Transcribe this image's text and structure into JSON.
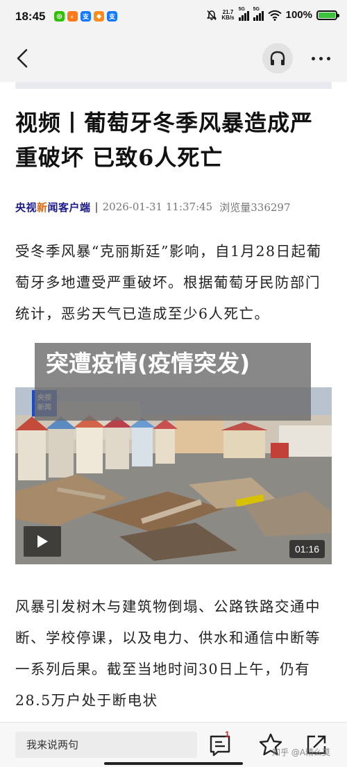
{
  "status_bar": {
    "time": "18:45",
    "apps": [
      {
        "name": "wechat",
        "color": "#2dc100",
        "glyph": "◎"
      },
      {
        "name": "xianyu",
        "color": "#ff7a1a",
        "glyph": "◐"
      },
      {
        "name": "alipay",
        "color": "#1677ff",
        "glyph": "支"
      },
      {
        "name": "taobao",
        "color": "#ff8c1a",
        "glyph": "◆"
      },
      {
        "name": "alipay-2",
        "color": "#1677ff",
        "glyph": "支"
      }
    ],
    "net_speed_value": "21.7",
    "net_speed_unit": "KB/s",
    "signal1_label": "5G",
    "signal2_label": "5G",
    "battery": "100%",
    "battery_level": 1.0,
    "battery_color": "#3cc23c"
  },
  "nav": {
    "back_icon": "chevron-left-icon",
    "listen_icon": "headphones-icon",
    "more_icon": "more-dots-icon"
  },
  "article": {
    "title": "视频丨葡萄牙冬季风暴造成严重破坏 已致6人死亡",
    "source_prefix": "央视",
    "source_highlight": "新",
    "source_suffix": "闻客户端",
    "separator": "|",
    "date": "2026-01-31 11:37:45",
    "views": "浏览量336297",
    "paragraph1": "受冬季风暴“克丽斯廷”影响，自1月28日起葡萄牙多地遭受严重破坏。根据葡萄牙民防部门统计，恶劣天气已造成至少6人死亡。",
    "paragraph2": "风暴引发树木与建筑物倒塌、公路铁路交通中断、学校停课，以及电力、供水和通信中断等一系列后果。截至当地时间30日上午，仍有28.5万户处于断电状"
  },
  "video": {
    "logo_line1": "央视",
    "logo_line2": "新闻",
    "duration": "01:16",
    "play_icon": "play-icon",
    "progress": 0
  },
  "overlay": {
    "text": "突遭疫情(疫情突发)"
  },
  "bottom_bar": {
    "comment_placeholder": "我来说两句",
    "comment_count": "1",
    "comment_icon": "comment-icon",
    "star_icon": "star-icon",
    "share_icon": "share-icon",
    "watermark": "知乎 @A精么莫"
  }
}
